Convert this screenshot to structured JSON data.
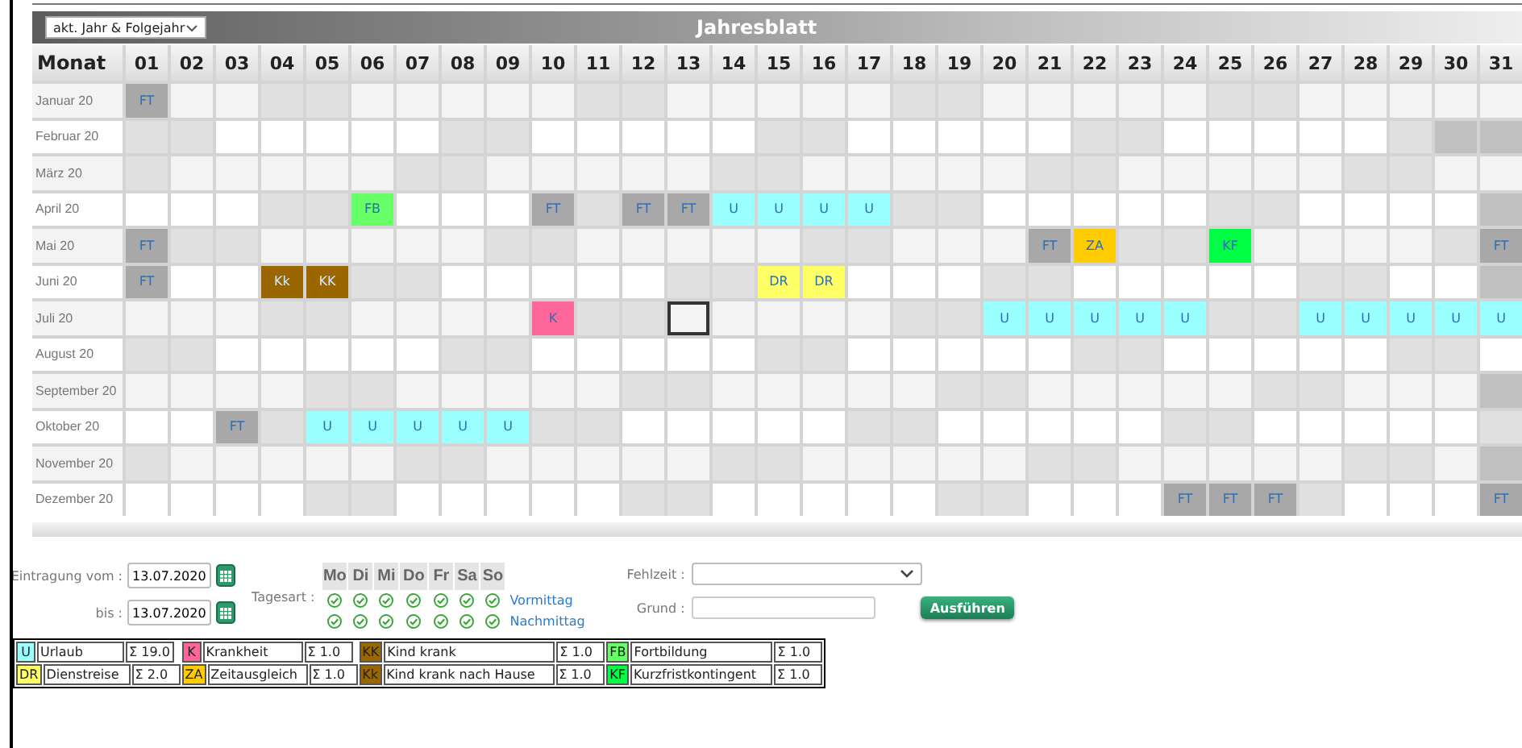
{
  "range_select": {
    "value": "akt. Jahr & Folgejahr"
  },
  "title": "Jahresblatt",
  "header": {
    "month_label": "Monat",
    "days": [
      "01",
      "02",
      "03",
      "04",
      "05",
      "06",
      "07",
      "08",
      "09",
      "10",
      "11",
      "12",
      "13",
      "14",
      "15",
      "16",
      "17",
      "18",
      "19",
      "20",
      "21",
      "22",
      "23",
      "24",
      "25",
      "26",
      "27",
      "28",
      "29",
      "30",
      "31"
    ]
  },
  "months": [
    {
      "label": "Januar 20",
      "cells": [
        {
          "kind": "entry",
          "code": "FT",
          "color": "#a8a8a8"
        },
        {
          "kind": "day"
        },
        {
          "kind": "day"
        },
        {
          "kind": "weekend"
        },
        {
          "kind": "weekend"
        },
        {
          "kind": "day"
        },
        {
          "kind": "day"
        },
        {
          "kind": "day"
        },
        {
          "kind": "day"
        },
        {
          "kind": "day"
        },
        {
          "kind": "weekend"
        },
        {
          "kind": "weekend"
        },
        {
          "kind": "day"
        },
        {
          "kind": "day"
        },
        {
          "kind": "day"
        },
        {
          "kind": "day"
        },
        {
          "kind": "day"
        },
        {
          "kind": "weekend"
        },
        {
          "kind": "weekend"
        },
        {
          "kind": "day"
        },
        {
          "kind": "day"
        },
        {
          "kind": "day"
        },
        {
          "kind": "day"
        },
        {
          "kind": "day"
        },
        {
          "kind": "weekend"
        },
        {
          "kind": "weekend"
        },
        {
          "kind": "day"
        },
        {
          "kind": "day"
        },
        {
          "kind": "day"
        },
        {
          "kind": "day"
        },
        {
          "kind": "day"
        }
      ]
    },
    {
      "label": "Februar 20",
      "cells": [
        {
          "kind": "weekend"
        },
        {
          "kind": "weekend"
        },
        {
          "kind": "day"
        },
        {
          "kind": "day"
        },
        {
          "kind": "day"
        },
        {
          "kind": "day"
        },
        {
          "kind": "day"
        },
        {
          "kind": "weekend"
        },
        {
          "kind": "weekend"
        },
        {
          "kind": "day"
        },
        {
          "kind": "day"
        },
        {
          "kind": "day"
        },
        {
          "kind": "day"
        },
        {
          "kind": "day"
        },
        {
          "kind": "weekend"
        },
        {
          "kind": "weekend"
        },
        {
          "kind": "day"
        },
        {
          "kind": "day"
        },
        {
          "kind": "day"
        },
        {
          "kind": "day"
        },
        {
          "kind": "day"
        },
        {
          "kind": "weekend"
        },
        {
          "kind": "weekend"
        },
        {
          "kind": "day"
        },
        {
          "kind": "day"
        },
        {
          "kind": "day"
        },
        {
          "kind": "day"
        },
        {
          "kind": "day"
        },
        {
          "kind": "weekend"
        },
        {
          "kind": "none"
        },
        {
          "kind": "none"
        }
      ]
    },
    {
      "label": "März 20",
      "cells": [
        {
          "kind": "weekend"
        },
        {
          "kind": "day"
        },
        {
          "kind": "day"
        },
        {
          "kind": "day"
        },
        {
          "kind": "day"
        },
        {
          "kind": "day"
        },
        {
          "kind": "weekend"
        },
        {
          "kind": "weekend"
        },
        {
          "kind": "day"
        },
        {
          "kind": "day"
        },
        {
          "kind": "day"
        },
        {
          "kind": "day"
        },
        {
          "kind": "day"
        },
        {
          "kind": "weekend"
        },
        {
          "kind": "weekend"
        },
        {
          "kind": "day"
        },
        {
          "kind": "day"
        },
        {
          "kind": "day"
        },
        {
          "kind": "day"
        },
        {
          "kind": "day"
        },
        {
          "kind": "weekend"
        },
        {
          "kind": "weekend"
        },
        {
          "kind": "day"
        },
        {
          "kind": "day"
        },
        {
          "kind": "day"
        },
        {
          "kind": "day"
        },
        {
          "kind": "day"
        },
        {
          "kind": "weekend"
        },
        {
          "kind": "weekend"
        },
        {
          "kind": "day"
        },
        {
          "kind": "day"
        }
      ]
    },
    {
      "label": "April 20",
      "cells": [
        {
          "kind": "day"
        },
        {
          "kind": "day"
        },
        {
          "kind": "day"
        },
        {
          "kind": "weekend"
        },
        {
          "kind": "weekend"
        },
        {
          "kind": "entry",
          "code": "FB",
          "color": "#66ff66"
        },
        {
          "kind": "day"
        },
        {
          "kind": "day"
        },
        {
          "kind": "day"
        },
        {
          "kind": "entry",
          "code": "FT",
          "color": "#a8a8a8"
        },
        {
          "kind": "weekend"
        },
        {
          "kind": "entry",
          "code": "FT",
          "color": "#a8a8a8"
        },
        {
          "kind": "entry",
          "code": "FT",
          "color": "#a8a8a8"
        },
        {
          "kind": "entry",
          "code": "U",
          "color": "#99ffff"
        },
        {
          "kind": "entry",
          "code": "U",
          "color": "#99ffff"
        },
        {
          "kind": "entry",
          "code": "U",
          "color": "#99ffff"
        },
        {
          "kind": "entry",
          "code": "U",
          "color": "#99ffff"
        },
        {
          "kind": "weekend"
        },
        {
          "kind": "weekend"
        },
        {
          "kind": "day"
        },
        {
          "kind": "day"
        },
        {
          "kind": "day"
        },
        {
          "kind": "day"
        },
        {
          "kind": "day"
        },
        {
          "kind": "weekend"
        },
        {
          "kind": "weekend"
        },
        {
          "kind": "day"
        },
        {
          "kind": "day"
        },
        {
          "kind": "day"
        },
        {
          "kind": "day"
        },
        {
          "kind": "none"
        }
      ]
    },
    {
      "label": "Mai 20",
      "cells": [
        {
          "kind": "entry",
          "code": "FT",
          "color": "#a8a8a8"
        },
        {
          "kind": "weekend"
        },
        {
          "kind": "weekend"
        },
        {
          "kind": "day"
        },
        {
          "kind": "day"
        },
        {
          "kind": "day"
        },
        {
          "kind": "day"
        },
        {
          "kind": "day"
        },
        {
          "kind": "weekend"
        },
        {
          "kind": "weekend"
        },
        {
          "kind": "day"
        },
        {
          "kind": "day"
        },
        {
          "kind": "day"
        },
        {
          "kind": "day"
        },
        {
          "kind": "day"
        },
        {
          "kind": "weekend"
        },
        {
          "kind": "weekend"
        },
        {
          "kind": "day"
        },
        {
          "kind": "day"
        },
        {
          "kind": "day"
        },
        {
          "kind": "entry",
          "code": "FT",
          "color": "#a8a8a8"
        },
        {
          "kind": "entry",
          "code": "ZA",
          "color": "#ffcc00"
        },
        {
          "kind": "weekend"
        },
        {
          "kind": "weekend"
        },
        {
          "kind": "entry",
          "code": "KF",
          "color": "#00ff44"
        },
        {
          "kind": "day"
        },
        {
          "kind": "day"
        },
        {
          "kind": "day"
        },
        {
          "kind": "day"
        },
        {
          "kind": "weekend"
        },
        {
          "kind": "entry",
          "code": "FT",
          "color": "#a8a8a8"
        }
      ]
    },
    {
      "label": "Juni 20",
      "cells": [
        {
          "kind": "entry",
          "code": "FT",
          "color": "#a8a8a8"
        },
        {
          "kind": "day"
        },
        {
          "kind": "day"
        },
        {
          "kind": "entry",
          "code": "Kk",
          "color": "#996600"
        },
        {
          "kind": "entry",
          "code": "KK",
          "color": "#996600"
        },
        {
          "kind": "weekend"
        },
        {
          "kind": "weekend"
        },
        {
          "kind": "day"
        },
        {
          "kind": "day"
        },
        {
          "kind": "day"
        },
        {
          "kind": "day"
        },
        {
          "kind": "day"
        },
        {
          "kind": "weekend"
        },
        {
          "kind": "weekend"
        },
        {
          "kind": "entry",
          "code": "DR",
          "color": "#ffff66"
        },
        {
          "kind": "entry",
          "code": "DR",
          "color": "#ffff66"
        },
        {
          "kind": "day"
        },
        {
          "kind": "day"
        },
        {
          "kind": "day"
        },
        {
          "kind": "weekend"
        },
        {
          "kind": "weekend"
        },
        {
          "kind": "day"
        },
        {
          "kind": "day"
        },
        {
          "kind": "day"
        },
        {
          "kind": "day"
        },
        {
          "kind": "day"
        },
        {
          "kind": "weekend"
        },
        {
          "kind": "weekend"
        },
        {
          "kind": "day"
        },
        {
          "kind": "day"
        },
        {
          "kind": "none"
        }
      ]
    },
    {
      "label": "Juli 20",
      "cells": [
        {
          "kind": "day"
        },
        {
          "kind": "day"
        },
        {
          "kind": "day"
        },
        {
          "kind": "weekend"
        },
        {
          "kind": "weekend"
        },
        {
          "kind": "day"
        },
        {
          "kind": "day"
        },
        {
          "kind": "day"
        },
        {
          "kind": "day"
        },
        {
          "kind": "entry",
          "code": "K",
          "color": "#ff6699"
        },
        {
          "kind": "weekend"
        },
        {
          "kind": "weekend"
        },
        {
          "kind": "cursor"
        },
        {
          "kind": "day"
        },
        {
          "kind": "day"
        },
        {
          "kind": "day"
        },
        {
          "kind": "day"
        },
        {
          "kind": "weekend"
        },
        {
          "kind": "weekend"
        },
        {
          "kind": "entry",
          "code": "U",
          "color": "#99ffff"
        },
        {
          "kind": "entry",
          "code": "U",
          "color": "#99ffff"
        },
        {
          "kind": "entry",
          "code": "U",
          "color": "#99ffff"
        },
        {
          "kind": "entry",
          "code": "U",
          "color": "#99ffff"
        },
        {
          "kind": "entry",
          "code": "U",
          "color": "#99ffff"
        },
        {
          "kind": "weekend"
        },
        {
          "kind": "weekend"
        },
        {
          "kind": "entry",
          "code": "U",
          "color": "#99ffff"
        },
        {
          "kind": "entry",
          "code": "U",
          "color": "#99ffff"
        },
        {
          "kind": "entry",
          "code": "U",
          "color": "#99ffff"
        },
        {
          "kind": "entry",
          "code": "U",
          "color": "#99ffff"
        },
        {
          "kind": "entry",
          "code": "U",
          "color": "#99ffff"
        }
      ]
    },
    {
      "label": "August 20",
      "cells": [
        {
          "kind": "weekend"
        },
        {
          "kind": "weekend"
        },
        {
          "kind": "day"
        },
        {
          "kind": "day"
        },
        {
          "kind": "day"
        },
        {
          "kind": "day"
        },
        {
          "kind": "day"
        },
        {
          "kind": "weekend"
        },
        {
          "kind": "weekend"
        },
        {
          "kind": "day"
        },
        {
          "kind": "day"
        },
        {
          "kind": "day"
        },
        {
          "kind": "day"
        },
        {
          "kind": "day"
        },
        {
          "kind": "weekend"
        },
        {
          "kind": "weekend"
        },
        {
          "kind": "day"
        },
        {
          "kind": "day"
        },
        {
          "kind": "day"
        },
        {
          "kind": "day"
        },
        {
          "kind": "day"
        },
        {
          "kind": "weekend"
        },
        {
          "kind": "weekend"
        },
        {
          "kind": "day"
        },
        {
          "kind": "day"
        },
        {
          "kind": "day"
        },
        {
          "kind": "day"
        },
        {
          "kind": "day"
        },
        {
          "kind": "weekend"
        },
        {
          "kind": "weekend"
        },
        {
          "kind": "day"
        }
      ]
    },
    {
      "label": "September 20",
      "cells": [
        {
          "kind": "day"
        },
        {
          "kind": "day"
        },
        {
          "kind": "day"
        },
        {
          "kind": "day"
        },
        {
          "kind": "weekend"
        },
        {
          "kind": "weekend"
        },
        {
          "kind": "day"
        },
        {
          "kind": "day"
        },
        {
          "kind": "day"
        },
        {
          "kind": "day"
        },
        {
          "kind": "day"
        },
        {
          "kind": "weekend"
        },
        {
          "kind": "weekend"
        },
        {
          "kind": "day"
        },
        {
          "kind": "day"
        },
        {
          "kind": "day"
        },
        {
          "kind": "day"
        },
        {
          "kind": "day"
        },
        {
          "kind": "weekend"
        },
        {
          "kind": "weekend"
        },
        {
          "kind": "day"
        },
        {
          "kind": "day"
        },
        {
          "kind": "day"
        },
        {
          "kind": "day"
        },
        {
          "kind": "day"
        },
        {
          "kind": "weekend"
        },
        {
          "kind": "weekend"
        },
        {
          "kind": "day"
        },
        {
          "kind": "day"
        },
        {
          "kind": "day"
        },
        {
          "kind": "none"
        }
      ]
    },
    {
      "label": "Oktober 20",
      "cells": [
        {
          "kind": "day"
        },
        {
          "kind": "day"
        },
        {
          "kind": "entry",
          "code": "FT",
          "color": "#a8a8a8"
        },
        {
          "kind": "weekend"
        },
        {
          "kind": "entry",
          "code": "U",
          "color": "#99ffff"
        },
        {
          "kind": "entry",
          "code": "U",
          "color": "#99ffff"
        },
        {
          "kind": "entry",
          "code": "U",
          "color": "#99ffff"
        },
        {
          "kind": "entry",
          "code": "U",
          "color": "#99ffff"
        },
        {
          "kind": "entry",
          "code": "U",
          "color": "#99ffff"
        },
        {
          "kind": "weekend"
        },
        {
          "kind": "weekend"
        },
        {
          "kind": "day"
        },
        {
          "kind": "day"
        },
        {
          "kind": "day"
        },
        {
          "kind": "day"
        },
        {
          "kind": "day"
        },
        {
          "kind": "weekend"
        },
        {
          "kind": "weekend"
        },
        {
          "kind": "day"
        },
        {
          "kind": "day"
        },
        {
          "kind": "day"
        },
        {
          "kind": "day"
        },
        {
          "kind": "day"
        },
        {
          "kind": "weekend"
        },
        {
          "kind": "weekend"
        },
        {
          "kind": "day"
        },
        {
          "kind": "day"
        },
        {
          "kind": "day"
        },
        {
          "kind": "day"
        },
        {
          "kind": "day"
        },
        {
          "kind": "weekend"
        }
      ]
    },
    {
      "label": "November 20",
      "cells": [
        {
          "kind": "weekend"
        },
        {
          "kind": "day"
        },
        {
          "kind": "day"
        },
        {
          "kind": "day"
        },
        {
          "kind": "day"
        },
        {
          "kind": "day"
        },
        {
          "kind": "weekend"
        },
        {
          "kind": "weekend"
        },
        {
          "kind": "day"
        },
        {
          "kind": "day"
        },
        {
          "kind": "day"
        },
        {
          "kind": "day"
        },
        {
          "kind": "day"
        },
        {
          "kind": "weekend"
        },
        {
          "kind": "weekend"
        },
        {
          "kind": "day"
        },
        {
          "kind": "day"
        },
        {
          "kind": "day"
        },
        {
          "kind": "day"
        },
        {
          "kind": "day"
        },
        {
          "kind": "weekend"
        },
        {
          "kind": "weekend"
        },
        {
          "kind": "day"
        },
        {
          "kind": "day"
        },
        {
          "kind": "day"
        },
        {
          "kind": "day"
        },
        {
          "kind": "day"
        },
        {
          "kind": "weekend"
        },
        {
          "kind": "weekend"
        },
        {
          "kind": "day"
        },
        {
          "kind": "none"
        }
      ]
    },
    {
      "label": "Dezember 20",
      "cells": [
        {
          "kind": "day"
        },
        {
          "kind": "day"
        },
        {
          "kind": "day"
        },
        {
          "kind": "day"
        },
        {
          "kind": "weekend"
        },
        {
          "kind": "weekend"
        },
        {
          "kind": "day"
        },
        {
          "kind": "day"
        },
        {
          "kind": "day"
        },
        {
          "kind": "day"
        },
        {
          "kind": "day"
        },
        {
          "kind": "weekend"
        },
        {
          "kind": "weekend"
        },
        {
          "kind": "day"
        },
        {
          "kind": "day"
        },
        {
          "kind": "day"
        },
        {
          "kind": "day"
        },
        {
          "kind": "day"
        },
        {
          "kind": "weekend"
        },
        {
          "kind": "weekend"
        },
        {
          "kind": "day"
        },
        {
          "kind": "day"
        },
        {
          "kind": "day"
        },
        {
          "kind": "entry",
          "code": "FT",
          "color": "#a8a8a8"
        },
        {
          "kind": "entry",
          "code": "FT",
          "color": "#a8a8a8"
        },
        {
          "kind": "entry",
          "code": "FT",
          "color": "#a8a8a8"
        },
        {
          "kind": "weekend"
        },
        {
          "kind": "day"
        },
        {
          "kind": "day"
        },
        {
          "kind": "day"
        },
        {
          "kind": "entry",
          "code": "FT",
          "color": "#a8a8a8"
        }
      ]
    }
  ],
  "form": {
    "from_label": "Eintragung vom :",
    "from_value": "13.07.2020",
    "to_label": "bis :",
    "to_value": "13.07.2020",
    "daytype_label": "Tagesart :",
    "weekdays": [
      "Mo",
      "Di",
      "Mi",
      "Do",
      "Fr",
      "Sa",
      "So"
    ],
    "half_days": [
      {
        "label": "Vormittag",
        "checked": [
          true,
          true,
          true,
          true,
          true,
          true,
          true
        ]
      },
      {
        "label": "Nachmittag",
        "checked": [
          true,
          true,
          true,
          true,
          true,
          true,
          true
        ]
      }
    ],
    "absence_label": "Fehlzeit :",
    "reason_label": "Grund :",
    "submit": "Ausführen"
  },
  "legend": [
    {
      "code": "U",
      "color": "#99ffff",
      "label": "Urlaub",
      "sum": "Σ 19.0"
    },
    {
      "code": "K",
      "color": "#ff6699",
      "label": "Krankheit",
      "sum": "Σ 1.0"
    },
    {
      "code": "KK",
      "color": "#996600",
      "label": "Kind krank",
      "sum": "Σ 1.0"
    },
    {
      "code": "FB",
      "color": "#66ff66",
      "label": "Fortbildung",
      "sum": "Σ 1.0"
    },
    {
      "code": "DR",
      "color": "#ffff66",
      "label": "Dienstreise",
      "sum": "Σ 2.0"
    },
    {
      "code": "ZA",
      "color": "#ffcc00",
      "label": "Zeitausgleich",
      "sum": "Σ 1.0"
    },
    {
      "code": "Kk",
      "color": "#996600",
      "label": "Kind krank nach Hause",
      "sum": "Σ 1.0"
    },
    {
      "code": "KF",
      "color": "#00ff44",
      "label": "Kurzfristkontingent",
      "sum": "Σ 1.0"
    }
  ]
}
